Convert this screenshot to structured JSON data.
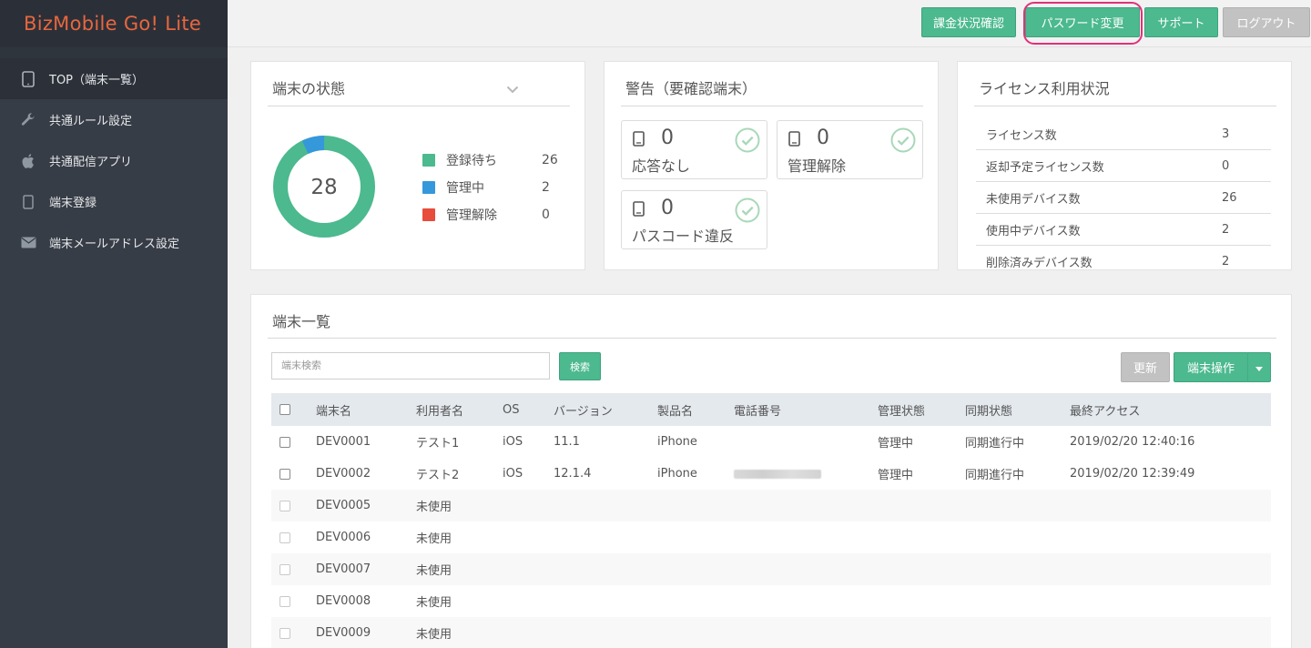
{
  "brand": {
    "title": "BizMobile Go! Lite"
  },
  "sidebar": {
    "items": [
      {
        "label": "TOP（端末一覧）",
        "icon": "tablet-icon",
        "active": true
      },
      {
        "label": "共通ルール設定",
        "icon": "wrench-icon"
      },
      {
        "label": "共通配信アプリ",
        "icon": "apple-icon"
      },
      {
        "label": "端末登録",
        "icon": "tablet-icon"
      },
      {
        "label": "端末メールアドレス設定",
        "icon": "envelope-icon"
      }
    ]
  },
  "topbar": {
    "billing": "課金状況確認",
    "password": "パスワード変更",
    "support": "サポート",
    "logout": "ログアウト"
  },
  "status_panel": {
    "title": "端末の状態",
    "total": "28",
    "legend": [
      {
        "label": "登録待ち",
        "value": "26",
        "color": "#4cb98f"
      },
      {
        "label": "管理中",
        "value": "2",
        "color": "#3498db"
      },
      {
        "label": "管理解除",
        "value": "0",
        "color": "#e74c3c"
      }
    ]
  },
  "warning_panel": {
    "title": "警告（要確認端末）",
    "cards": [
      {
        "count": "0",
        "label": "応答なし"
      },
      {
        "count": "0",
        "label": "管理解除"
      },
      {
        "count": "0",
        "label": "パスコード違反"
      }
    ]
  },
  "license_panel": {
    "title": "ライセンス利用状況",
    "rows": [
      {
        "label": "ライセンス数",
        "value": "3"
      },
      {
        "label": "返却予定ライセンス数",
        "value": "0"
      },
      {
        "label": "未使用デバイス数",
        "value": "26"
      },
      {
        "label": "使用中デバイス数",
        "value": "2"
      },
      {
        "label": "削除済みデバイス数",
        "value": "2"
      }
    ]
  },
  "device_list": {
    "title": "端末一覧",
    "search_placeholder": "端末検索",
    "search_button": "検索",
    "refresh_button": "更新",
    "operate_button": "端末操作",
    "columns": [
      "端末名",
      "利用者名",
      "OS",
      "バージョン",
      "製品名",
      "電話番号",
      "管理状態",
      "同期状態",
      "最終アクセス"
    ],
    "rows": [
      {
        "name": "DEV0001",
        "user": "テスト1",
        "os": "iOS",
        "version": "11.1",
        "product": "iPhone",
        "phone": "",
        "mgmt": "管理中",
        "sync": "同期進行中",
        "access": "2019/02/20 12:40:16"
      },
      {
        "name": "DEV0002",
        "user": "テスト2",
        "os": "iOS",
        "version": "12.1.4",
        "product": "iPhone",
        "phone": "",
        "mgmt": "管理中",
        "sync": "同期進行中",
        "access": "2019/02/20 12:39:49"
      },
      {
        "name": "DEV0005",
        "user": "未使用"
      },
      {
        "name": "DEV0006",
        "user": "未使用"
      },
      {
        "name": "DEV0007",
        "user": "未使用"
      },
      {
        "name": "DEV0008",
        "user": "未使用"
      },
      {
        "name": "DEV0009",
        "user": "未使用"
      }
    ]
  }
}
